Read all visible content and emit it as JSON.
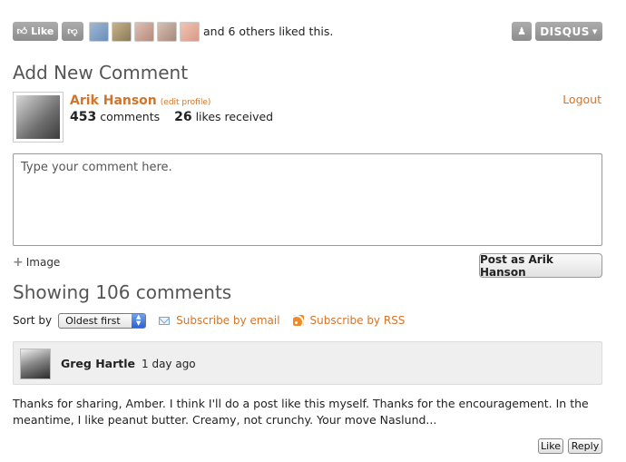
{
  "likebar": {
    "like_label": "Like",
    "liked_text": "and 6 others liked this.",
    "disqus_label": "DISQUS",
    "avatar_colors": [
      "#6b8fb8",
      "#8a7a5a",
      "#b48a7c",
      "#a5887a",
      "#d79a88"
    ]
  },
  "compose": {
    "title": "Add New Comment",
    "user_name": "Arik Hanson",
    "edit_profile": "(edit profile)",
    "comments_count": "453",
    "comments_label": "comments",
    "likes_count": "26",
    "likes_label": "likes received",
    "logout": "Logout",
    "placeholder": "Type your comment here.",
    "image_label": "Image",
    "post_button": "Post as Arik Hanson"
  },
  "listing": {
    "title": "Showing 106 comments",
    "sort_label": "Sort by",
    "sort_value": "Oldest first",
    "subscribe_email": "Subscribe by email",
    "subscribe_rss": "Subscribe by RSS"
  },
  "comments": [
    {
      "author": "Greg Hartle",
      "time": "1 day ago",
      "body": "Thanks for sharing, Amber. I think I'll do a post like this myself. Thanks for the encouragement. In the meantime, I like peanut butter. Creamy, not crunchy. Your move Naslund...",
      "like_label": "Like",
      "reply_label": "Reply"
    }
  ],
  "colors": {
    "accent": "#d4742a",
    "button_gray": "#9a9a9a"
  }
}
